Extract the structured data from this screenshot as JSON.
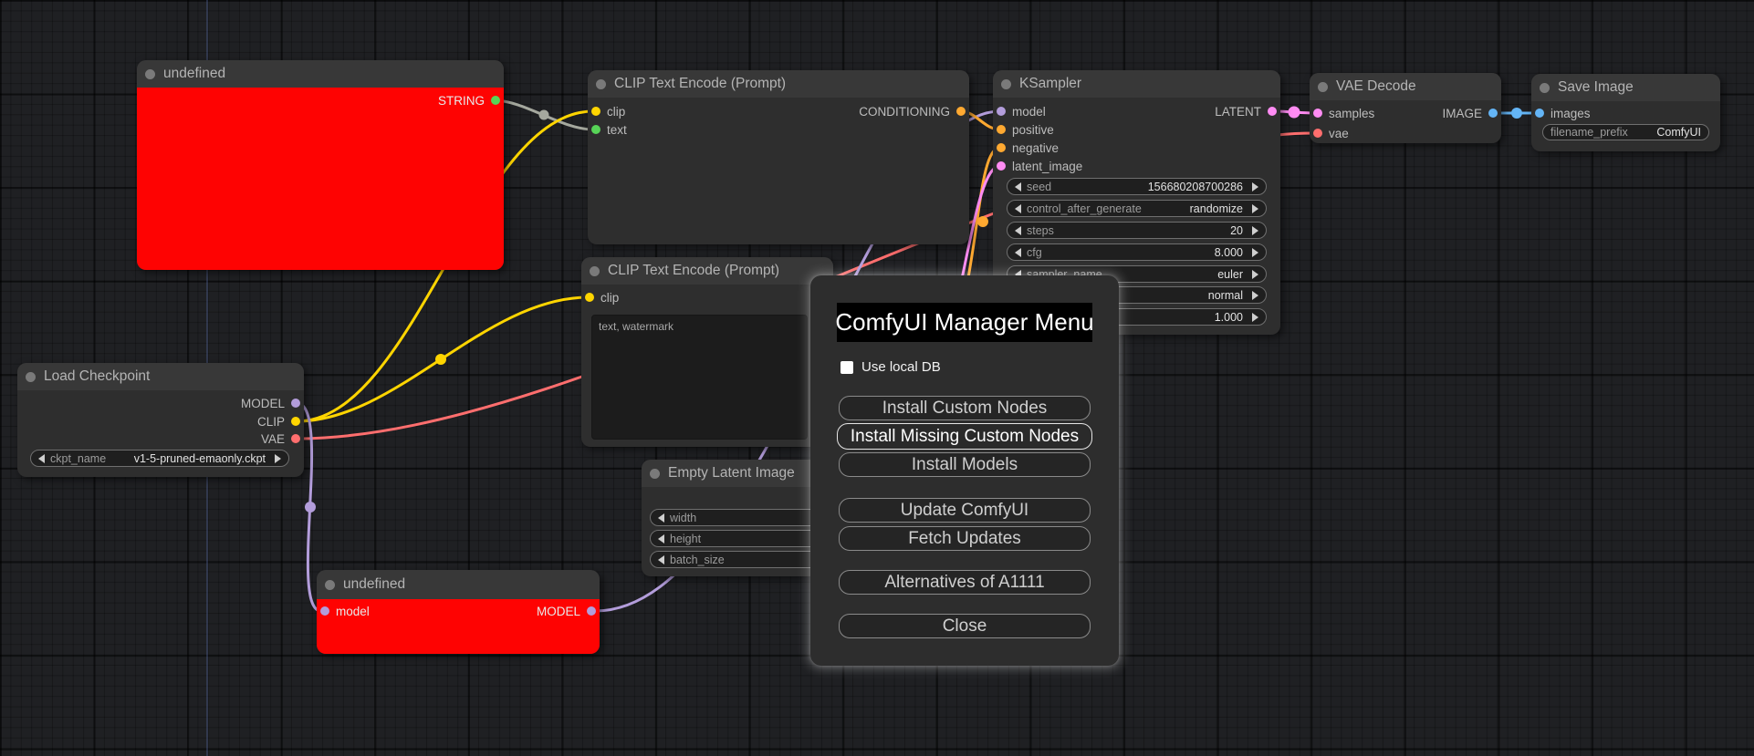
{
  "colors": {
    "model": "#b39ddb",
    "clip": "#ffd500",
    "vae": "#ff6e6e",
    "conditioning": "#ffa931",
    "latent": "#ff8cf3",
    "image": "#64b5f6",
    "string": "#57d457",
    "string_wire": "#a5a89e",
    "node_error": "#fe0302"
  },
  "nodes": {
    "undefined_top": {
      "title": "undefined",
      "output": "STRING"
    },
    "clip_encode_1": {
      "title": "CLIP Text Encode (Prompt)",
      "input_clip": "clip",
      "input_text": "text",
      "output": "CONDITIONING"
    },
    "clip_encode_2": {
      "title": "CLIP Text Encode (Prompt)",
      "input_clip": "clip",
      "prompt_text": "text, watermark"
    },
    "ksampler": {
      "title": "KSampler",
      "inputs": [
        "model",
        "positive",
        "negative",
        "latent_image"
      ],
      "output": "LATENT",
      "widgets": [
        {
          "label": "seed",
          "value": "156680208700286"
        },
        {
          "label": "control_after_generate",
          "value": "randomize"
        },
        {
          "label": "steps",
          "value": "20"
        },
        {
          "label": "cfg",
          "value": "8.000"
        },
        {
          "label": "sampler_name",
          "value": "euler"
        },
        {
          "label": "",
          "value": "normal"
        },
        {
          "label": "",
          "value": "1.000"
        }
      ]
    },
    "vae_decode": {
      "title": "VAE Decode",
      "input_samples": "samples",
      "input_vae": "vae",
      "output": "IMAGE"
    },
    "save_image": {
      "title": "Save Image",
      "input": "images",
      "widget": {
        "label": "filename_prefix",
        "value": "ComfyUI"
      }
    },
    "load_checkpoint": {
      "title": "Load Checkpoint",
      "outputs": [
        "MODEL",
        "CLIP",
        "VAE"
      ],
      "widget": {
        "label": "ckpt_name",
        "value": "v1-5-pruned-emaonly.ckpt"
      }
    },
    "empty_latent": {
      "title": "Empty Latent Image",
      "widgets": [
        {
          "label": "width"
        },
        {
          "label": "height"
        },
        {
          "label": "batch_size"
        }
      ]
    },
    "undefined_bottom": {
      "title": "undefined",
      "input": "model",
      "output": "MODEL"
    }
  },
  "dialog": {
    "title": "ComfyUI Manager Menu",
    "checkbox": {
      "label": "Use local DB",
      "checked": false
    },
    "buttons": [
      "Install Custom Nodes",
      "Install Missing Custom Nodes",
      "Install Models",
      "Update ComfyUI",
      "Fetch Updates",
      "Alternatives of A1111",
      "Close"
    ],
    "highlighted_button": "Install Missing Custom Nodes"
  }
}
